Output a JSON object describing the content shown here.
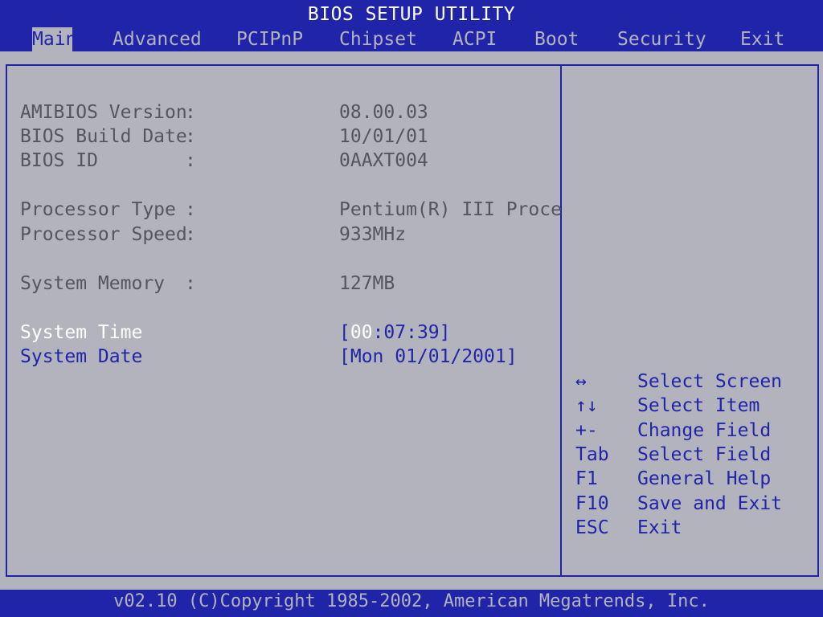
{
  "title": "BIOS SETUP UTILITY",
  "menu": [
    {
      "label": "Main",
      "active": true
    },
    {
      "label": "Advanced"
    },
    {
      "label": "PCIPnP"
    },
    {
      "label": "Chipset"
    },
    {
      "label": "ACPI"
    },
    {
      "label": "Boot"
    },
    {
      "label": "Security"
    },
    {
      "label": "Exit"
    }
  ],
  "info": {
    "amibios_version": {
      "label": "AMIBIOS Version",
      "sep": ":",
      "value": "08.00.03"
    },
    "bios_build_date": {
      "label": "BIOS Build Date",
      "sep": ":",
      "value": "10/01/01"
    },
    "bios_id": {
      "label": "BIOS ID",
      "sep": ":",
      "value": "0AAXT004"
    },
    "processor_type": {
      "label": "Processor Type",
      "sep": ":",
      "value": "Pentium(R) III Proce"
    },
    "processor_speed": {
      "label": "Processor Speed",
      "sep": ":",
      "value": "933MHz"
    },
    "system_memory": {
      "label": "System Memory",
      "sep": ":",
      "value": "127MB"
    }
  },
  "settings": {
    "system_time": {
      "label": "System Time",
      "open": "[",
      "value_hl": "00",
      "value_rest": ":07:39]"
    },
    "system_date": {
      "label": "System Date",
      "value": "[Mon 01/01/2001]"
    }
  },
  "help": [
    {
      "key": "↔",
      "desc": "Select Screen"
    },
    {
      "key": "↑↓",
      "desc": "Select Item"
    },
    {
      "key": "+-",
      "desc": "Change Field"
    },
    {
      "key": "Tab",
      "desc": "Select Field"
    },
    {
      "key": "F1",
      "desc": "General Help"
    },
    {
      "key": "F10",
      "desc": "Save and Exit"
    },
    {
      "key": "ESC",
      "desc": "Exit"
    }
  ],
  "footer": "v02.10 (C)Copyright 1985-2002, American Megatrends, Inc.",
  "colors": {
    "bios_blue": "#1f24a8",
    "panel_gray": "#b3b3bd",
    "text_dim": "#555560",
    "text_highlight": "#ffffff"
  }
}
